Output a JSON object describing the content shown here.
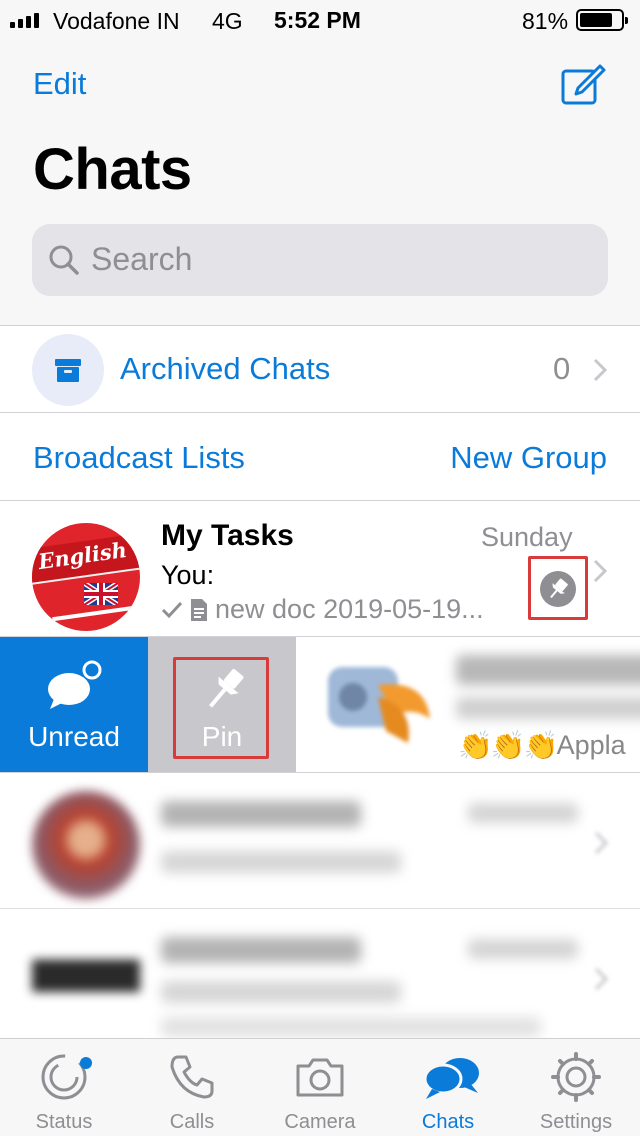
{
  "status_bar": {
    "carrier": "Vodafone IN",
    "network": "4G",
    "time": "5:52 PM",
    "battery_percent": "81%",
    "battery_level": 0.81
  },
  "header": {
    "edit_label": "Edit",
    "title": "Chats",
    "search_placeholder": "Search"
  },
  "archived": {
    "label": "Archived Chats",
    "count": "0"
  },
  "links": {
    "broadcast": "Broadcast Lists",
    "new_group": "New Group"
  },
  "chats": [
    {
      "name": "My Tasks",
      "time": "Sunday",
      "preview_sender": "You:",
      "preview_text": "new doc 2019-05-19...",
      "pinned": true,
      "avatar_text": "English"
    }
  ],
  "swipe_actions": {
    "unread_label": "Unread",
    "pin_label": "Pin",
    "preview_fragment": "Appla"
  },
  "tab_bar": {
    "active": "Chats",
    "tabs": [
      {
        "label": "Status",
        "icon": "status-icon"
      },
      {
        "label": "Calls",
        "icon": "phone-icon"
      },
      {
        "label": "Camera",
        "icon": "camera-icon"
      },
      {
        "label": "Chats",
        "icon": "chats-icon"
      },
      {
        "label": "Settings",
        "icon": "gear-icon"
      }
    ]
  },
  "colors": {
    "accent": "#0a7bd8",
    "highlight": "#d93a3a",
    "secondary_text": "#8e8e93",
    "pin_action_bg": "#c7c7cc"
  }
}
